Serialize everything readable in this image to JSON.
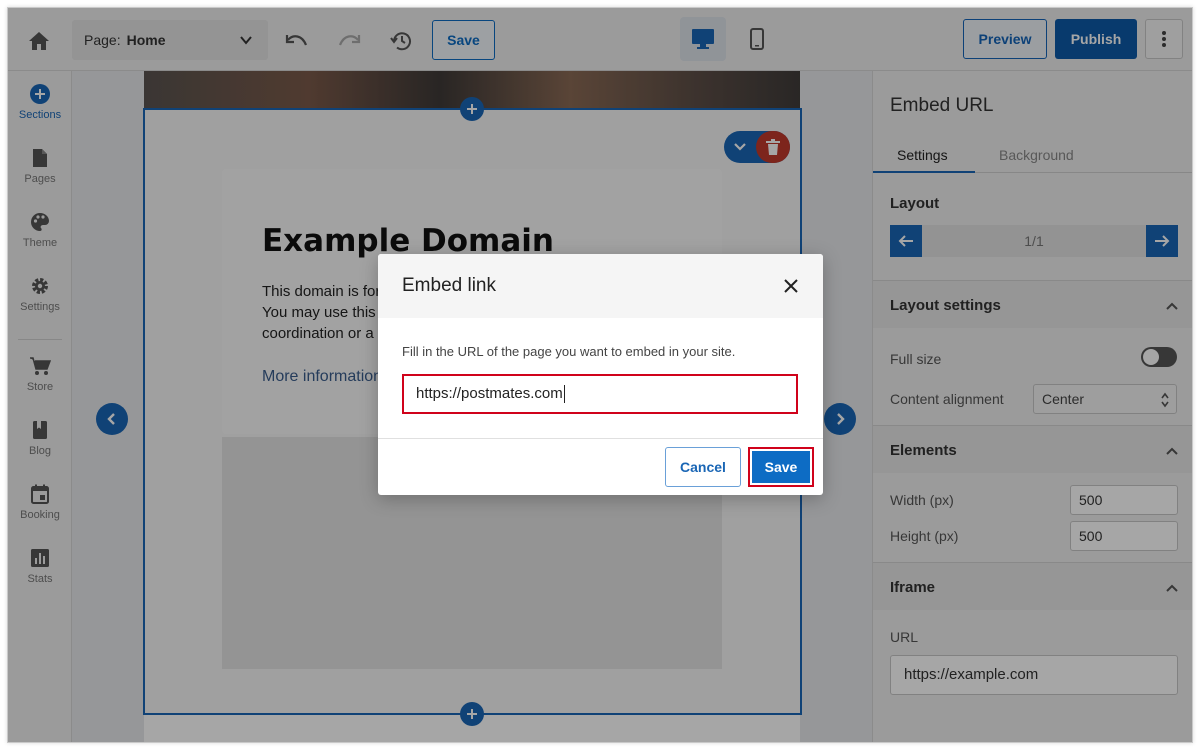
{
  "topbar": {
    "page_label": "Page:",
    "page_value": "Home",
    "save_label": "Save",
    "preview_label": "Preview",
    "publish_label": "Publish"
  },
  "sidebar": {
    "items": [
      {
        "label": "Sections",
        "icon": "plus-circle-icon"
      },
      {
        "label": "Pages",
        "icon": "page-icon"
      },
      {
        "label": "Theme",
        "icon": "palette-icon"
      },
      {
        "label": "Settings",
        "icon": "gear-icon"
      },
      {
        "label": "Store",
        "icon": "cart-icon"
      },
      {
        "label": "Blog",
        "icon": "book-icon"
      },
      {
        "label": "Booking",
        "icon": "calendar-icon"
      },
      {
        "label": "Stats",
        "icon": "chart-icon"
      }
    ]
  },
  "canvas": {
    "title": "Example Domain",
    "paragraph_lines": [
      "This domain is for",
      "You may use this",
      "coordination or a"
    ],
    "link_text": "More information"
  },
  "dialog": {
    "title": "Embed link",
    "instruction": "Fill in the URL of the page you want to embed in your site.",
    "url_value": "https://postmates.com",
    "cancel_label": "Cancel",
    "save_label": "Save"
  },
  "panel": {
    "title": "Embed URL",
    "tabs": [
      "Settings",
      "Background"
    ],
    "layout_label": "Layout",
    "layout_count": "1/1",
    "layout_settings_label": "Layout settings",
    "full_size_label": "Full size",
    "content_alignment_label": "Content alignment",
    "content_alignment_value": "Center",
    "elements_label": "Elements",
    "width_label": "Width (px)",
    "width_value": "500",
    "height_label": "Height (px)",
    "height_value": "500",
    "iframe_label": "Iframe",
    "url_label": "URL",
    "url_value": "https://example.com"
  },
  "colors": {
    "accent": "#1a66b5",
    "danger": "#d0021b"
  }
}
